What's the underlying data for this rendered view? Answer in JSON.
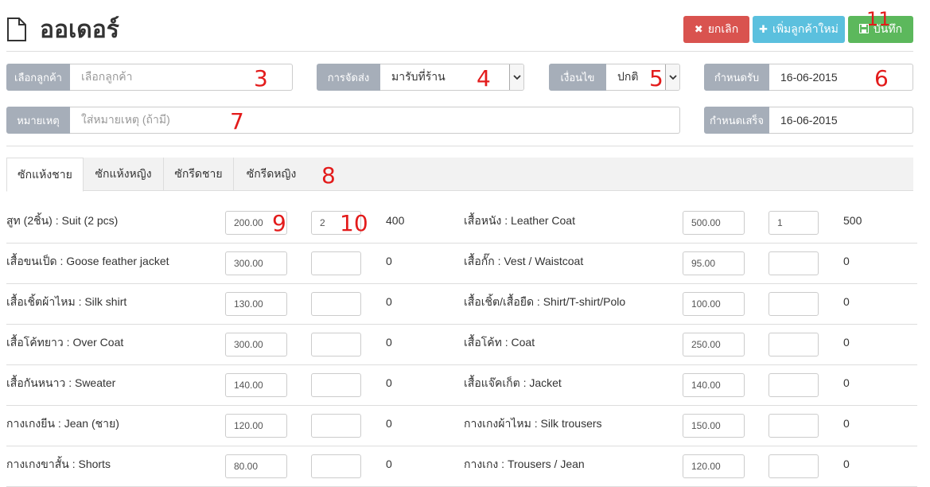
{
  "header": {
    "title": "ออเดอร์",
    "cancel_label": "ยกเลิก",
    "add_customer_label": "เพิ่มลูกค้าใหม่",
    "save_label": "บันทึก"
  },
  "form": {
    "customer": {
      "label": "เลือกลูกค้า",
      "placeholder": "เลือกลูกค้า"
    },
    "delivery": {
      "label": "การจัดส่ง",
      "value": "มารับที่ร้าน"
    },
    "condition": {
      "label": "เงื่อนไข",
      "value": "ปกติ"
    },
    "pickup_date": {
      "label": "กำหนดรับ",
      "value": "16-06-2015"
    },
    "note": {
      "label": "หมายเหตุ",
      "placeholder": "ใส่หมายเหตุ (ถ้ามี)"
    },
    "finish_date": {
      "label": "กำหนดเสร็จ",
      "value": "16-06-2015"
    }
  },
  "tabs": [
    "ซักแห้งชาย",
    "ซักแห้งหญิง",
    "ซักรีดชาย",
    "ซักรีดหญิง"
  ],
  "callouts": [
    "3",
    "4",
    "5",
    "6",
    "7",
    "8",
    "9",
    "10",
    "11"
  ],
  "items_left": [
    {
      "name": "สูท (2ชิ้น) : Suit (2 pcs)",
      "price": "200.00",
      "qty": "2",
      "total": "400"
    },
    {
      "name": "เสื้อขนเป็ด : Goose feather jacket",
      "price": "300.00",
      "qty": "",
      "total": "0"
    },
    {
      "name": "เสื้อเชิ้ตผ้าไหม : Silk shirt",
      "price": "130.00",
      "qty": "",
      "total": "0"
    },
    {
      "name": "เสื้อโค้ทยาว : Over Coat",
      "price": "300.00",
      "qty": "",
      "total": "0"
    },
    {
      "name": "เสื้อกันหนาว : Sweater",
      "price": "140.00",
      "qty": "",
      "total": "0"
    },
    {
      "name": "กางเกงยีน : Jean (ชาย)",
      "price": "120.00",
      "qty": "",
      "total": "0"
    },
    {
      "name": "กางเกงขาสั้น : Shorts",
      "price": "80.00",
      "qty": "",
      "total": "0"
    }
  ],
  "items_right": [
    {
      "name": "เสื้อหนัง : Leather Coat",
      "price": "500.00",
      "qty": "1",
      "total": "500"
    },
    {
      "name": "เสื้อกั๊ก : Vest / Waistcoat",
      "price": "95.00",
      "qty": "",
      "total": "0"
    },
    {
      "name": "เสื้อเชิ้ต/เสื้อยืด : Shirt/T-shirt/Polo",
      "price": "100.00",
      "qty": "",
      "total": "0"
    },
    {
      "name": "เสื้อโค้ท : Coat",
      "price": "250.00",
      "qty": "",
      "total": "0"
    },
    {
      "name": "เสื้อแจ๊คเก็ต : Jacket",
      "price": "140.00",
      "qty": "",
      "total": "0"
    },
    {
      "name": "กางเกงผ้าไหม : Silk trousers",
      "price": "150.00",
      "qty": "",
      "total": "0"
    },
    {
      "name": "กางเกง : Trousers / Jean",
      "price": "120.00",
      "qty": "",
      "total": "0"
    }
  ],
  "icons": {
    "page": "file-icon",
    "cancel": "close-icon",
    "add": "plus-icon",
    "save": "floppy-disk-icon",
    "select": "chevron-down-icon"
  },
  "colors": {
    "cancel": "#d9534f",
    "add": "#5bc0de",
    "save": "#5cb85c",
    "addon": "#a6aeb9",
    "callout": "#e31b1b"
  }
}
